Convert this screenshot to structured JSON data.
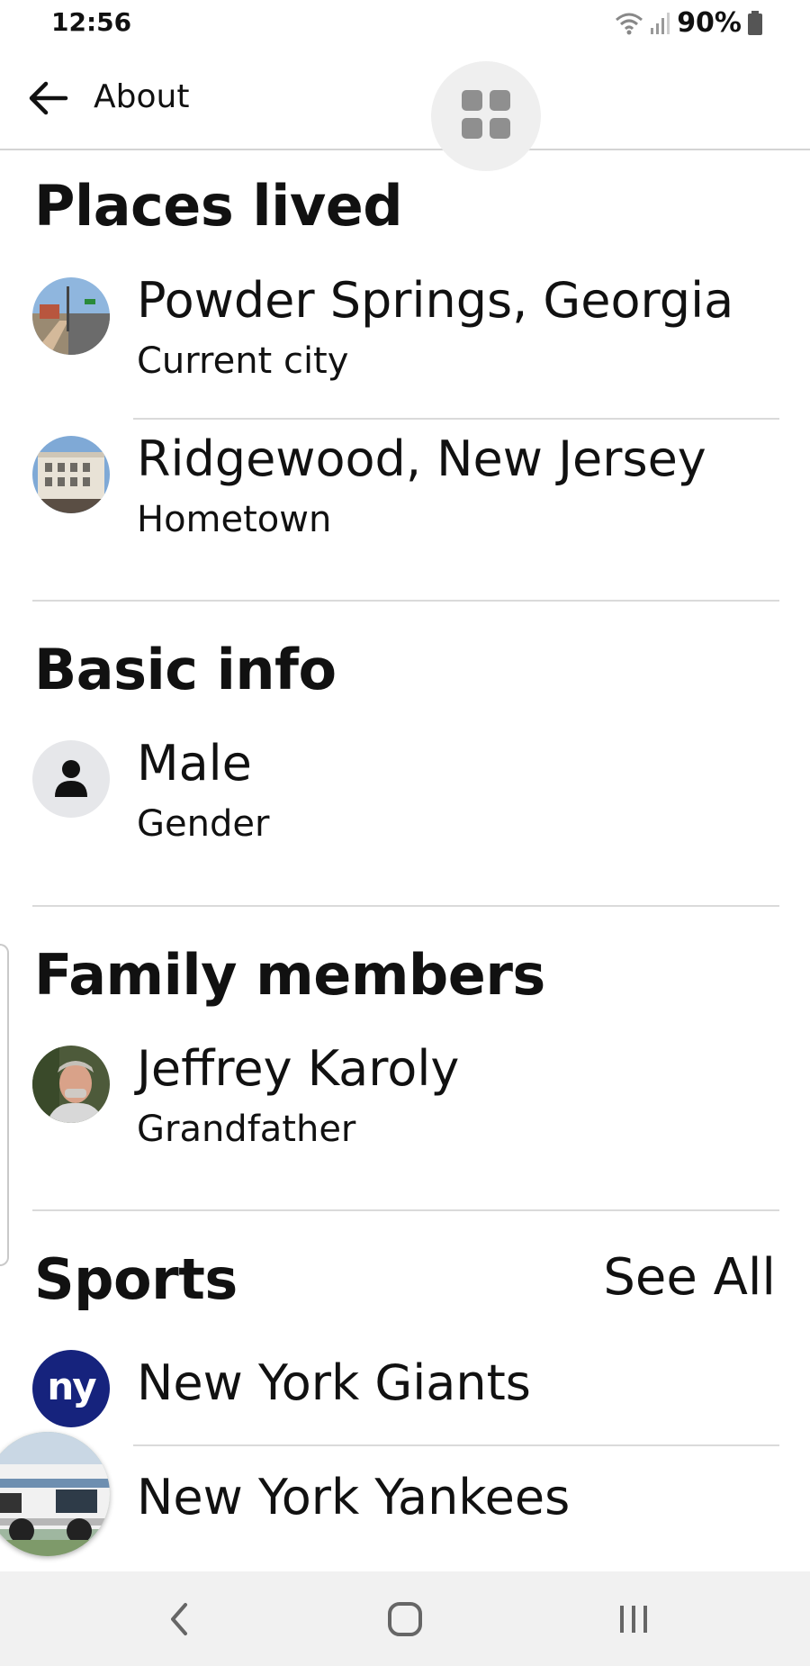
{
  "status_bar": {
    "time": "12:56",
    "battery": "90%",
    "icons": [
      "wifi-icon",
      "signal-icon",
      "battery-icon"
    ]
  },
  "header": {
    "back_icon": "arrow-left-icon",
    "title": "About",
    "menu_icon": "grid-icon"
  },
  "places_lived": {
    "title": "Places lived",
    "items": [
      {
        "name": "Powder Springs, Georgia",
        "label": "Current city"
      },
      {
        "name": "Ridgewood, New Jersey",
        "label": "Hometown"
      }
    ]
  },
  "basic_info": {
    "title": "Basic info",
    "items": [
      {
        "value": "Male",
        "label": "Gender",
        "icon": "person-icon"
      }
    ]
  },
  "family_members": {
    "title": "Family members",
    "items": [
      {
        "name": "Jeffrey Karoly",
        "relation": "Grandfather"
      }
    ]
  },
  "sports": {
    "title": "Sports",
    "see_all": "See All",
    "items": [
      {
        "name": "New York Giants",
        "logo_text": "ny",
        "logo_color": "#16237d"
      },
      {
        "name": "New York Yankees"
      }
    ]
  },
  "nav_bar": {
    "icons": [
      "back-nav-icon",
      "home-nav-icon",
      "recents-nav-icon"
    ]
  },
  "colors": {
    "background": "#ffffff",
    "divider": "#dadada",
    "giants_blue": "#16237d",
    "nav_background": "#f1f1f1"
  }
}
